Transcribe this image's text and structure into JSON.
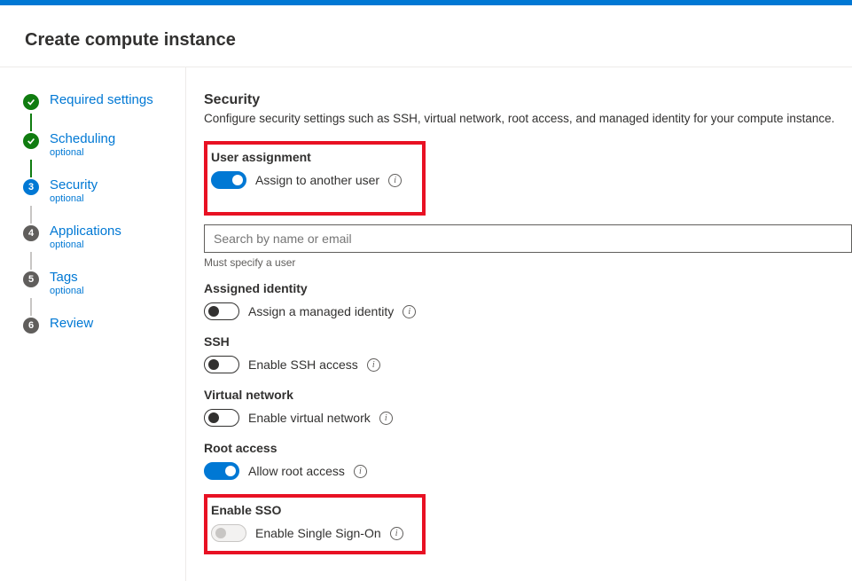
{
  "page_title": "Create compute instance",
  "sidebar": {
    "steps": [
      {
        "label": "Required settings",
        "sub": "",
        "state": "done"
      },
      {
        "label": "Scheduling",
        "sub": "optional",
        "state": "done"
      },
      {
        "label": "Security",
        "sub": "optional",
        "state": "active",
        "num": "3"
      },
      {
        "label": "Applications",
        "sub": "optional",
        "state": "pending",
        "num": "4"
      },
      {
        "label": "Tags",
        "sub": "optional",
        "state": "pending",
        "num": "5"
      },
      {
        "label": "Review",
        "sub": "",
        "state": "pending",
        "num": "6"
      }
    ]
  },
  "security": {
    "title": "Security",
    "desc": "Configure security settings such as SSH, virtual network, root access, and managed identity for your compute instance.",
    "user_assignment": {
      "title": "User assignment",
      "toggle_label": "Assign to another user",
      "toggle_on": true,
      "search_placeholder": "Search by name or email",
      "search_hint": "Must specify a user"
    },
    "assigned_identity": {
      "title": "Assigned identity",
      "toggle_label": "Assign a managed identity",
      "toggle_on": false
    },
    "ssh": {
      "title": "SSH",
      "toggle_label": "Enable SSH access",
      "toggle_on": false
    },
    "vnet": {
      "title": "Virtual network",
      "toggle_label": "Enable virtual network",
      "toggle_on": false
    },
    "root": {
      "title": "Root access",
      "toggle_label": "Allow root access",
      "toggle_on": true
    },
    "sso": {
      "title": "Enable SSO",
      "toggle_label": "Enable Single Sign-On",
      "toggle_on": false,
      "disabled": true
    }
  }
}
